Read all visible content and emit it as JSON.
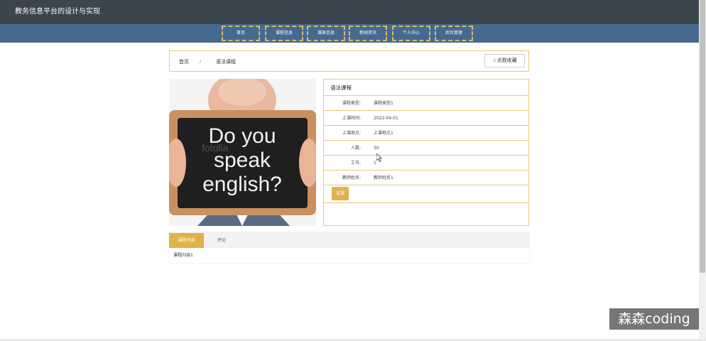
{
  "header": {
    "title": "教务信息平台的设计与实现"
  },
  "nav": {
    "items": [
      {
        "label": "首页"
      },
      {
        "label": "课程信息"
      },
      {
        "label": "课表信息"
      },
      {
        "label": "新闻资讯"
      },
      {
        "label": "个人中心"
      },
      {
        "label": "后台管理"
      }
    ]
  },
  "breadcrumb": {
    "home": "首页",
    "separator": "/",
    "current": "语法课程"
  },
  "actions": {
    "favorite_label": "☆点我收藏",
    "enroll_label": "选课"
  },
  "course": {
    "title": "语法课程",
    "image_text": {
      "line1": "Do you",
      "line2": "speak",
      "line3": "english?",
      "stock_mark": "fotolia"
    },
    "fields": [
      {
        "label": "课程类型:",
        "value": "课程类型1"
      },
      {
        "label": "上课时间:",
        "value": "2022-04-01"
      },
      {
        "label": "上课地点:",
        "value": "上课地点1"
      },
      {
        "label": "人数:",
        "value": "50"
      },
      {
        "label": "工号:",
        "value": "1"
      },
      {
        "label": "教师姓名:",
        "value": "教师姓名1"
      }
    ]
  },
  "tabs": {
    "items": [
      {
        "label": "课程内容",
        "active": true
      },
      {
        "label": "评论",
        "active": false
      }
    ],
    "content": "课程内容1"
  },
  "watermark": {
    "text": "森森coding"
  },
  "colors": {
    "topbar": "#3a4550",
    "navbar": "#466a8f",
    "accent": "#e2b24a",
    "border": "#e8c77a"
  }
}
